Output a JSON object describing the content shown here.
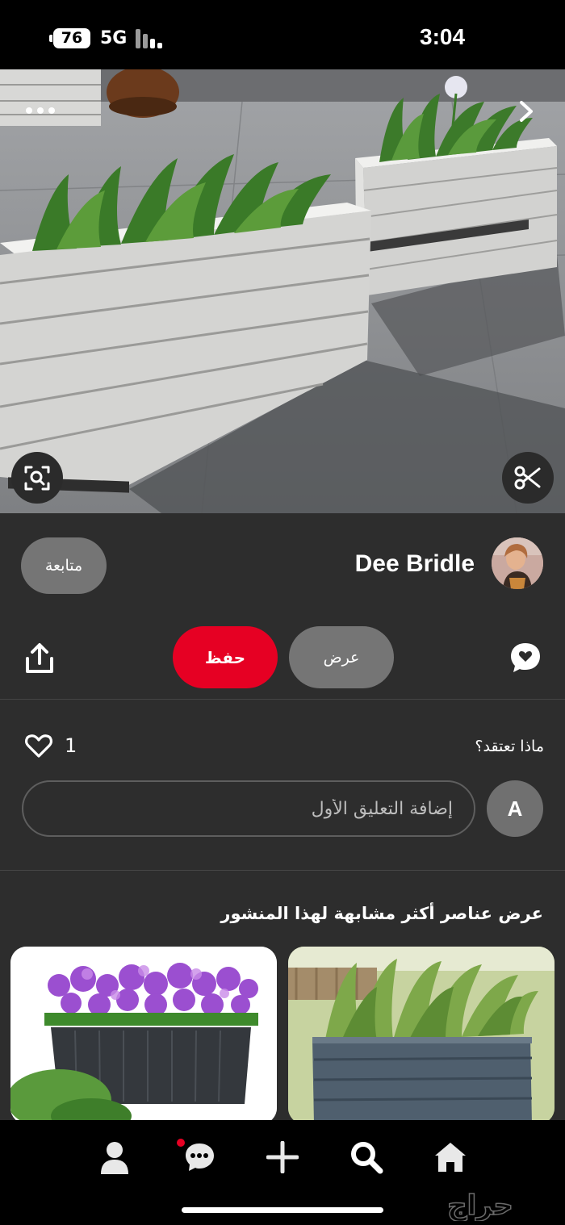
{
  "status_bar": {
    "battery": "76",
    "network": "5G",
    "time": "3:04"
  },
  "hero": {
    "icons": [
      "more-icon",
      "chevron-right-icon",
      "visual-search-icon",
      "scissors-icon"
    ]
  },
  "creator": {
    "name": "Dee Bridle",
    "follow_label": "متابعة"
  },
  "actions": {
    "save_label": "حفظ",
    "view_label": "عرض",
    "icons": [
      "share-icon",
      "comment-bubble-icon"
    ]
  },
  "engagement": {
    "like_count": "1",
    "prompt": "ماذا تعتقد؟"
  },
  "comment": {
    "placeholder": "إضافة التعليق الأول",
    "user_initial": "A"
  },
  "more_like_this": {
    "title": "عرض عناصر أكثر مشابهة لهذا المنشور"
  },
  "bottom_nav": {
    "items": [
      "profile-icon",
      "messages-icon",
      "create-icon",
      "search-icon",
      "home-icon"
    ],
    "messages_badge_color": "#e60023"
  },
  "colors": {
    "accent": "#e60023",
    "background": "#2d2d2d",
    "pill": "#757575"
  },
  "watermark": "حراج"
}
